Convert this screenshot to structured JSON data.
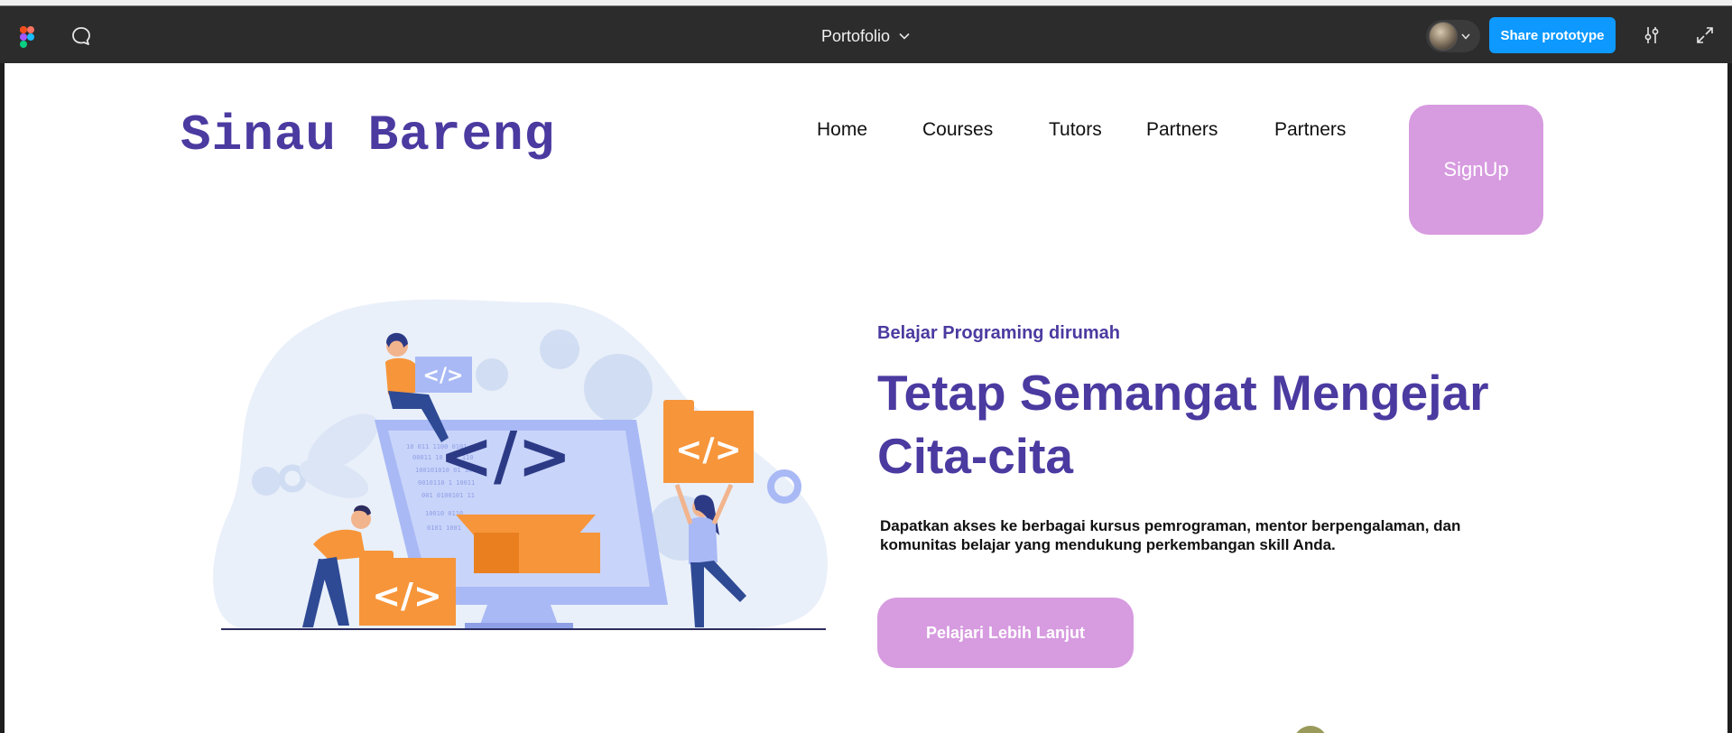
{
  "toolbar": {
    "file_title": "Portofolio",
    "share_label": "Share prototype",
    "icons": [
      "figma-logo",
      "comment-icon",
      "chevron-down-icon",
      "avatar",
      "settings-sliders-icon",
      "expand-icon"
    ]
  },
  "site": {
    "brand": "Sinau Bareng",
    "nav": [
      {
        "label": "Home"
      },
      {
        "label": "Courses"
      },
      {
        "label": "Tutors"
      },
      {
        "label": "Partners"
      },
      {
        "label": "Partners"
      }
    ],
    "signup_label": "SignUp"
  },
  "hero": {
    "subheading": "Belajar Programing dirumah",
    "headline": "Tetap Semangat Mengejar Cita-cita",
    "description": "Dapatkan akses ke berbagai kursus pemrograman, mentor berpengalaman, dan komunitas belajar yang mendukung perkembangan skill Anda.",
    "cta_label": "Pelajari Lebih Lanjut",
    "illustration": {
      "code_symbol": "</>"
    }
  },
  "colors": {
    "brand": "#4b3aa0",
    "accent_button": "#d79be0",
    "toolbar_bg": "#2c2c2c",
    "share_blue": "#0d99ff",
    "illus_orange": "#f7953a",
    "illus_blue": "#a9b9f5"
  }
}
